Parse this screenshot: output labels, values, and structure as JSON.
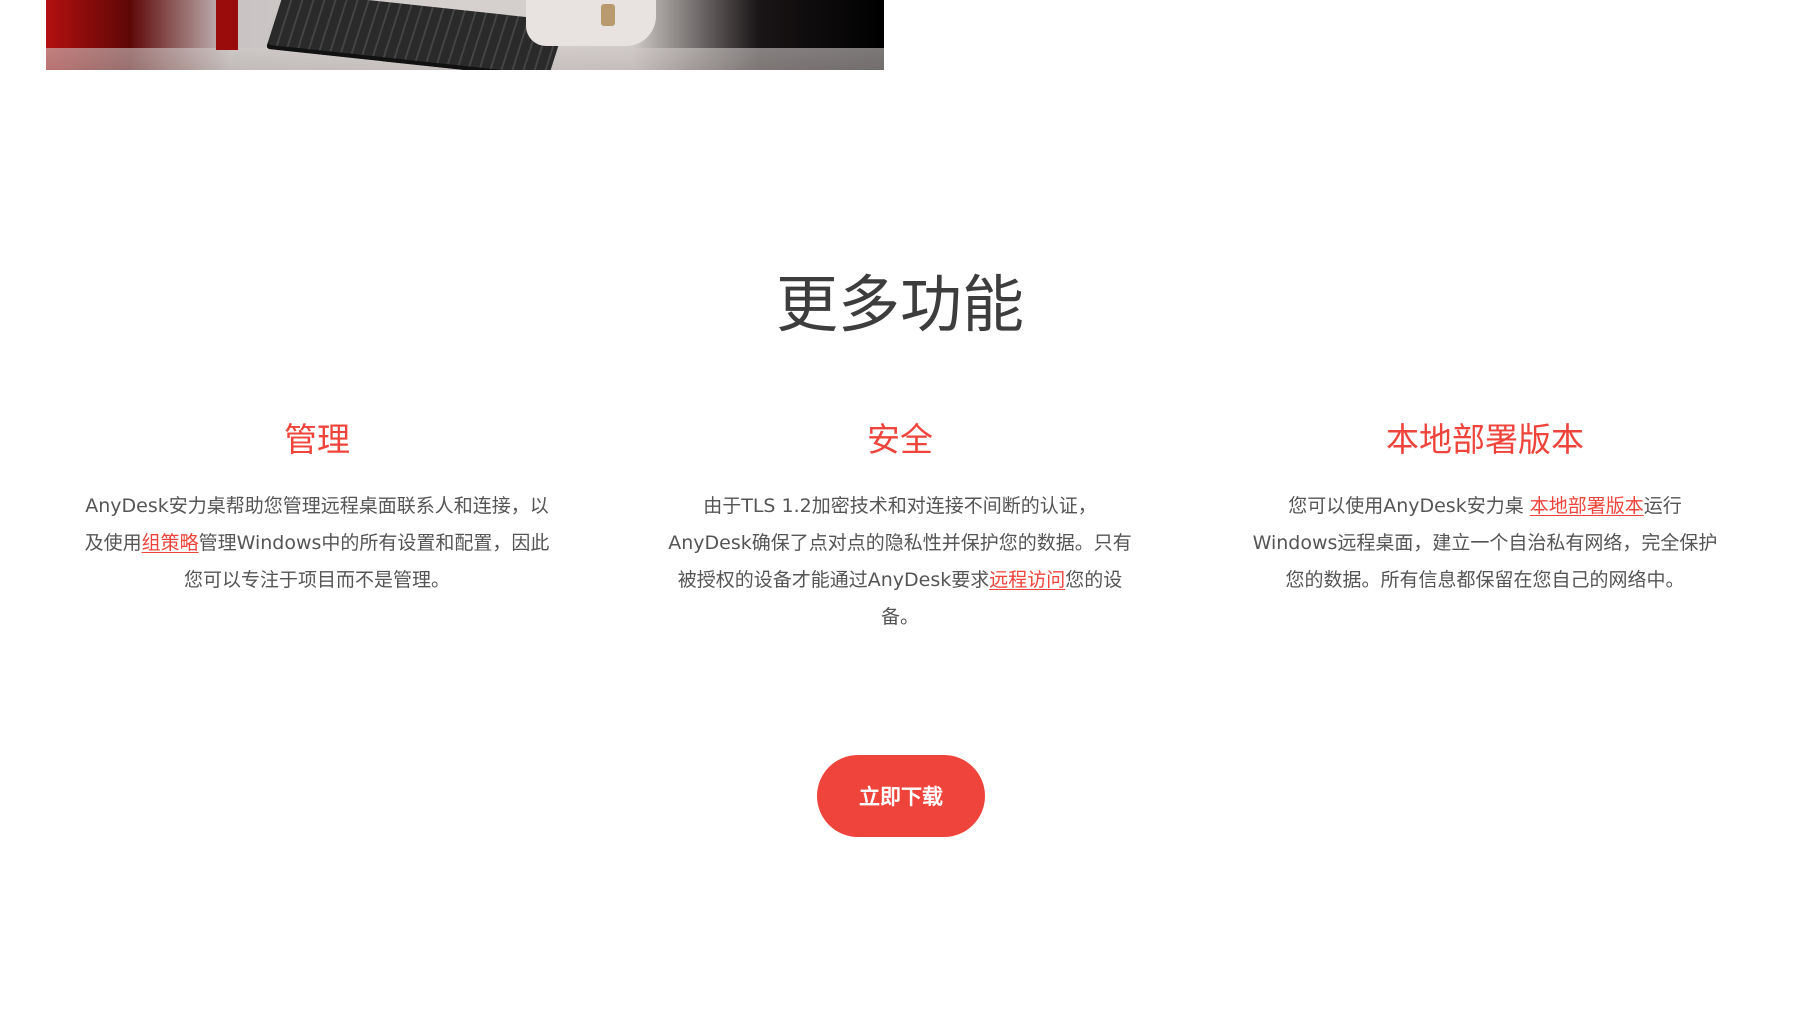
{
  "hero": {
    "image_desc": "photo"
  },
  "section": {
    "title": "更多功能"
  },
  "features": [
    {
      "title": "管理",
      "text_before": "AnyDesk安力桌帮助您管理远程桌面联系人和连接，以及使用",
      "link": "组策略",
      "text_after": "管理Windows中的所有设置和配置，因此您可以专注于项目而不是管理。"
    },
    {
      "title": "安全",
      "text_before": "由于TLS 1.2加密技术和对连接不间断的认证，AnyDesk确保了点对点的隐私性并保护您的数据。只有被授权的设备才能通过AnyDesk要求",
      "link": "远程访问",
      "text_after": "您的设备。"
    },
    {
      "title": "本地部署版本",
      "text_before": "您可以使用AnyDesk安力桌 ",
      "link": "本地部署版本",
      "text_after": "运行Windows远程桌面，建立一个自治私有网络，完全保护您的数据。所有信息都保留在您自己的网络中。"
    }
  ],
  "cta": {
    "download_label": "立即下载"
  },
  "colors": {
    "accent": "#ef443b",
    "heading": "#3d3d3d",
    "body": "#555555"
  }
}
